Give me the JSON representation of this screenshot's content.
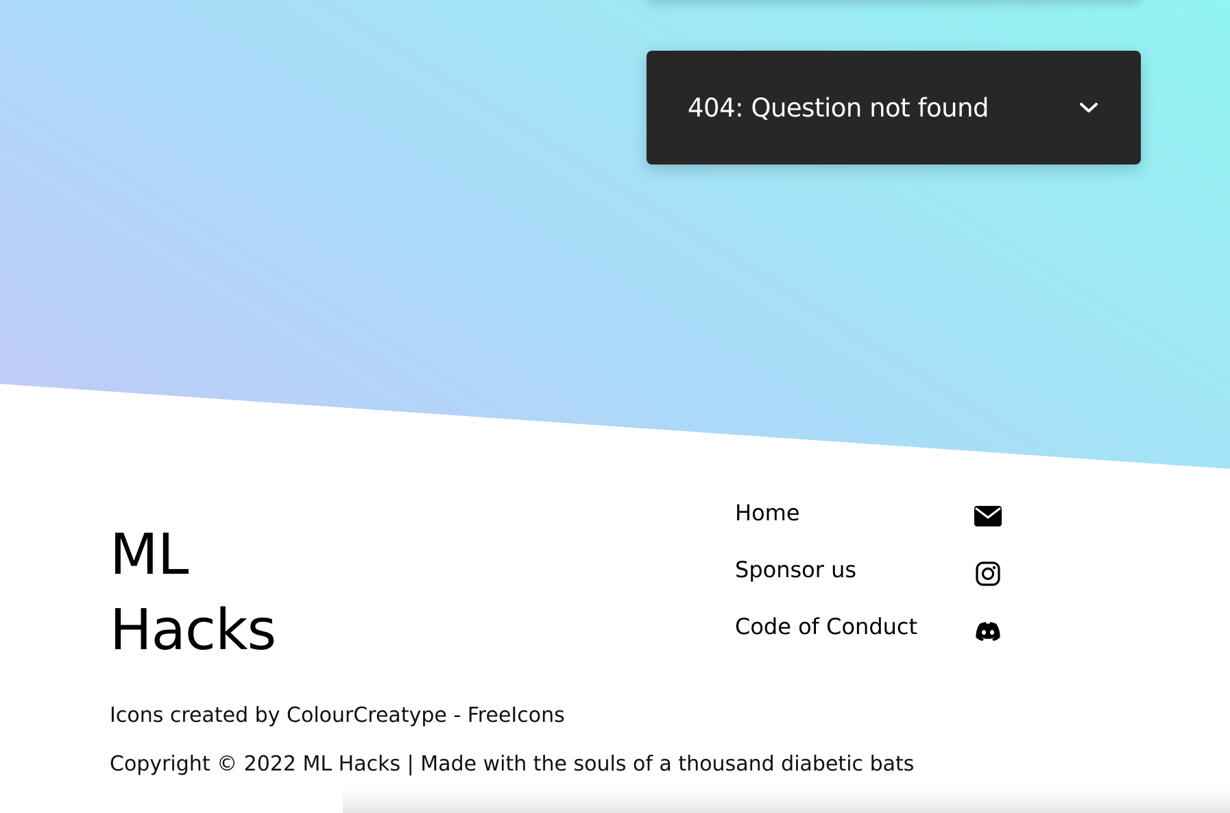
{
  "accordion": {
    "title": "404: Question not found",
    "icon": "chevron-down-icon"
  },
  "footer": {
    "brand_line1": "ML",
    "brand_line2": "Hacks",
    "links": [
      {
        "label": "Home"
      },
      {
        "label": "Sponsor us"
      },
      {
        "label": "Code of Conduct"
      }
    ],
    "social_icons": [
      "mail-icon",
      "instagram-icon",
      "discord-icon"
    ],
    "credits": "Icons created by ColourCreatype - FreeIcons",
    "copyright": "Copyright © 2022 ML Hacks | Made with the souls of a thousand diabetic bats"
  },
  "colors": {
    "gradient_start": "#c3c9f8",
    "gradient_end": "#91f5f2",
    "accordion_bg": "#272727",
    "text": "#000000"
  }
}
